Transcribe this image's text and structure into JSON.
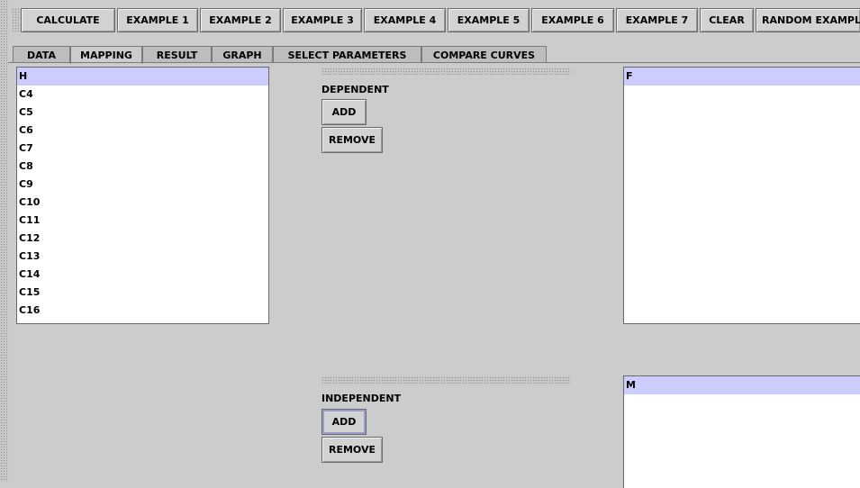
{
  "toolbar": {
    "buttons": [
      "CALCULATE",
      "EXAMPLE 1",
      "EXAMPLE 2",
      "EXAMPLE 3",
      "EXAMPLE 4",
      "EXAMPLE 5",
      "EXAMPLE 6",
      "EXAMPLE 7",
      "CLEAR",
      "RANDOM EXAMPLE"
    ]
  },
  "tabs": [
    "DATA",
    "MAPPING",
    "RESULT",
    "GRAPH",
    "SELECT PARAMETERS",
    "COMPARE CURVES"
  ],
  "active_tab": "MAPPING",
  "variables_list": {
    "items": [
      "H",
      "C4",
      "C5",
      "C6",
      "C7",
      "C8",
      "C9",
      "C10",
      "C11",
      "C12",
      "C13",
      "C14",
      "C15",
      "C16"
    ],
    "selected": "H"
  },
  "dependent": {
    "label": "DEPENDENT",
    "add_label": "ADD",
    "remove_label": "REMOVE",
    "items": [
      "F"
    ]
  },
  "independent": {
    "label": "INDEPENDENT",
    "add_label": "ADD",
    "remove_label": "REMOVE",
    "items": [
      "M"
    ]
  },
  "colors": {
    "background": "#cccccc",
    "selection": "#ccccff",
    "list_background": "#ffffff"
  }
}
